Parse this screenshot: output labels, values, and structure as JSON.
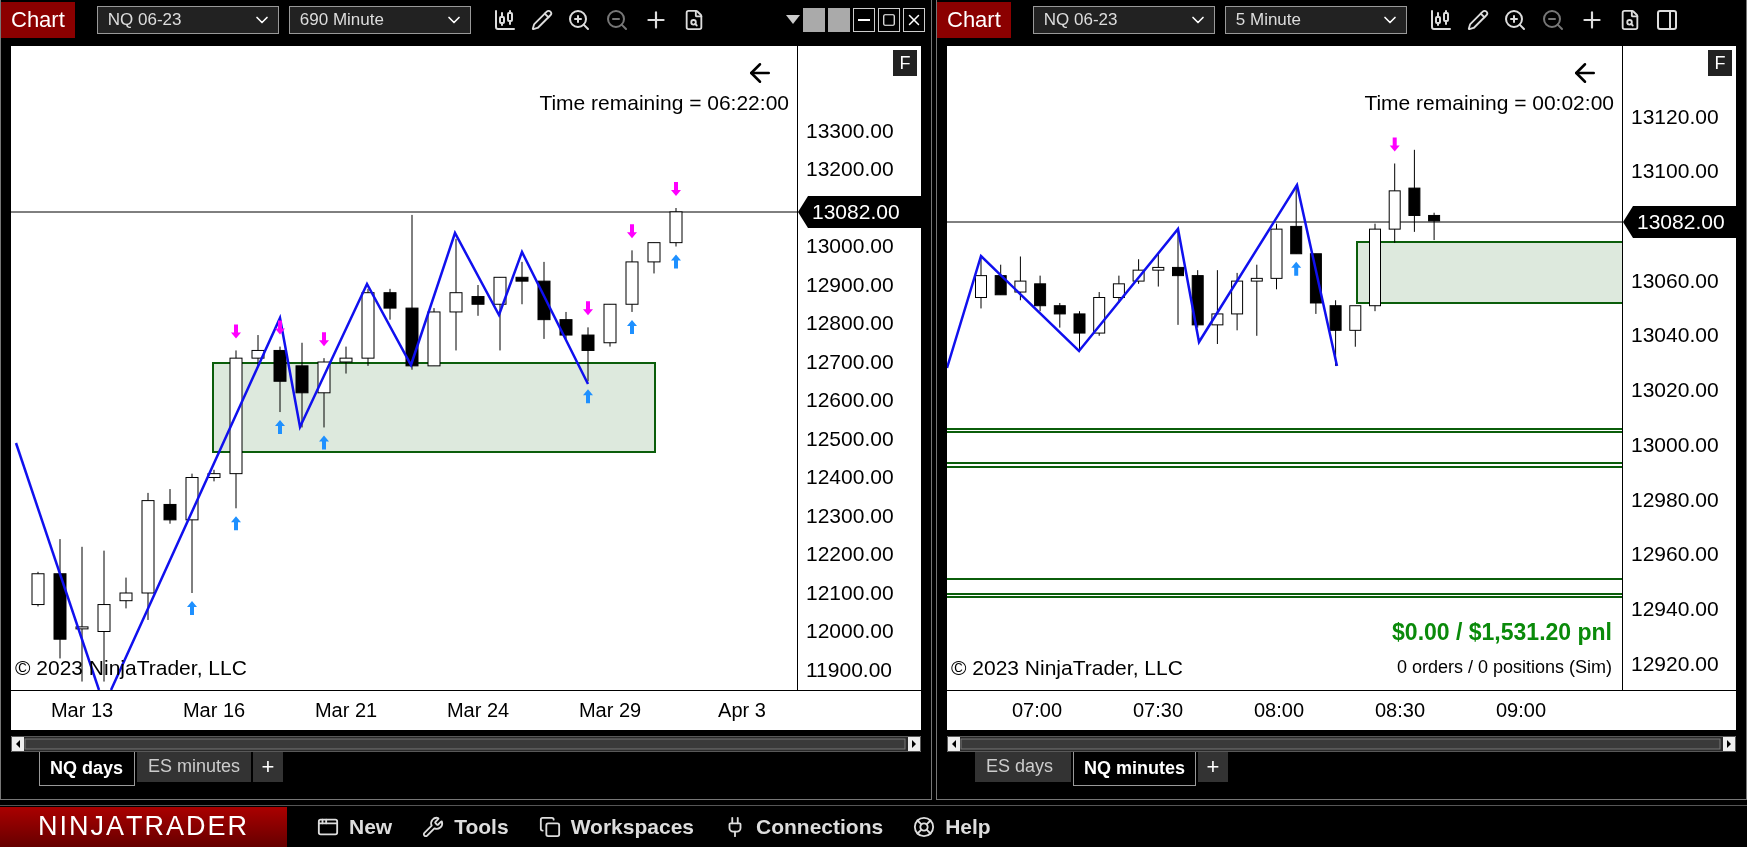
{
  "windows": [
    {
      "title": "Chart",
      "instrument": "NQ 06-23",
      "interval": "690 Minute",
      "window_buttons": true,
      "chart": {
        "time_remaining": "Time remaining = 06:22:00",
        "flag": "F",
        "last_price": "13082.00",
        "copyright": "© 2023 NinjaTrader, LLC",
        "price_axis": [
          "13300.00",
          "13200.00",
          "13000.00",
          "12900.00",
          "12800.00",
          "12700.00",
          "12600.00",
          "12500.00",
          "12400.00",
          "12300.00",
          "12200.00",
          "12100.00",
          "12000.00",
          "11900.00"
        ],
        "date_axis": [
          "Mar 13",
          "Mar 16",
          "Mar 21",
          "Mar 24",
          "Mar 29",
          "Apr 3"
        ]
      },
      "tabs": [
        {
          "label": "NQ days",
          "selected": true
        },
        {
          "label": "ES minutes",
          "selected": false
        }
      ],
      "add_tab": "+"
    },
    {
      "title": "Chart",
      "instrument": "NQ 06-23",
      "interval": "5 Minute",
      "window_buttons": false,
      "chart": {
        "time_remaining": "Time remaining = 00:02:00",
        "flag": "F",
        "last_price": "13082.00",
        "copyright": "© 2023 NinjaTrader, LLC",
        "pnl": "$0.00 / $1,531.20 pnl",
        "orders": "0 orders / 0 positions (Sim)",
        "price_axis": [
          "13120.00",
          "13100.00",
          "13060.00",
          "13040.00",
          "13020.00",
          "13000.00",
          "12980.00",
          "12960.00",
          "12940.00",
          "12920.00"
        ],
        "date_axis": [
          "07:00",
          "07:30",
          "08:00",
          "08:30",
          "09:00"
        ]
      },
      "tabs": [
        {
          "label": "ES days",
          "selected": false
        },
        {
          "label": "NQ minutes",
          "selected": true
        }
      ],
      "add_tab": "+"
    }
  ],
  "taskbar": {
    "logo": "NINJA**TRADER**",
    "menu": [
      {
        "label": "New",
        "kind": "new"
      },
      {
        "label": "Tools",
        "kind": "tools"
      },
      {
        "label": "Workspaces",
        "kind": "workspaces"
      },
      {
        "label": "Connections",
        "kind": "connections"
      },
      {
        "label": "Help",
        "kind": "help"
      }
    ]
  }
}
